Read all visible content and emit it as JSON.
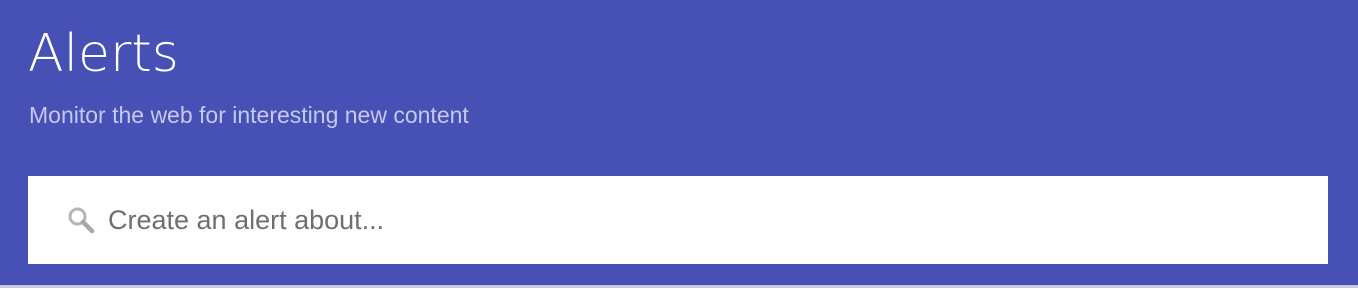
{
  "header": {
    "title": "Alerts",
    "subtitle": "Monitor the web for interesting new content",
    "background_color": "#4751b5"
  },
  "search": {
    "placeholder": "Create an alert about...",
    "value": "",
    "icon": "search-icon"
  }
}
